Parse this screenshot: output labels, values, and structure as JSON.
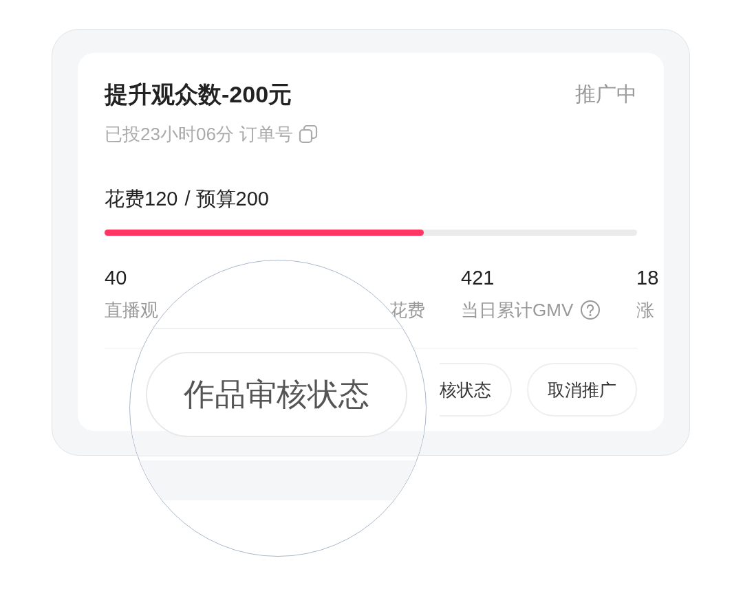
{
  "card": {
    "title": "提升观众数-200元",
    "status": "推广中",
    "elapsed": "已投23小时06分",
    "order_label": "订单号",
    "spend": "花费120",
    "budget": "/ 预算200",
    "budget_progress": {
      "level": 0.6
    },
    "stats": [
      {
        "value": "40",
        "label": "直播观"
      },
      {
        "label": "花费"
      },
      {
        "value": "421",
        "label": "当日累计GMV",
        "help": true
      },
      {
        "value": "18",
        "label": "涨"
      }
    ],
    "buttons": [
      "核状态",
      "取消推广"
    ]
  },
  "magnifier": {
    "button": "作品审核状态"
  }
}
